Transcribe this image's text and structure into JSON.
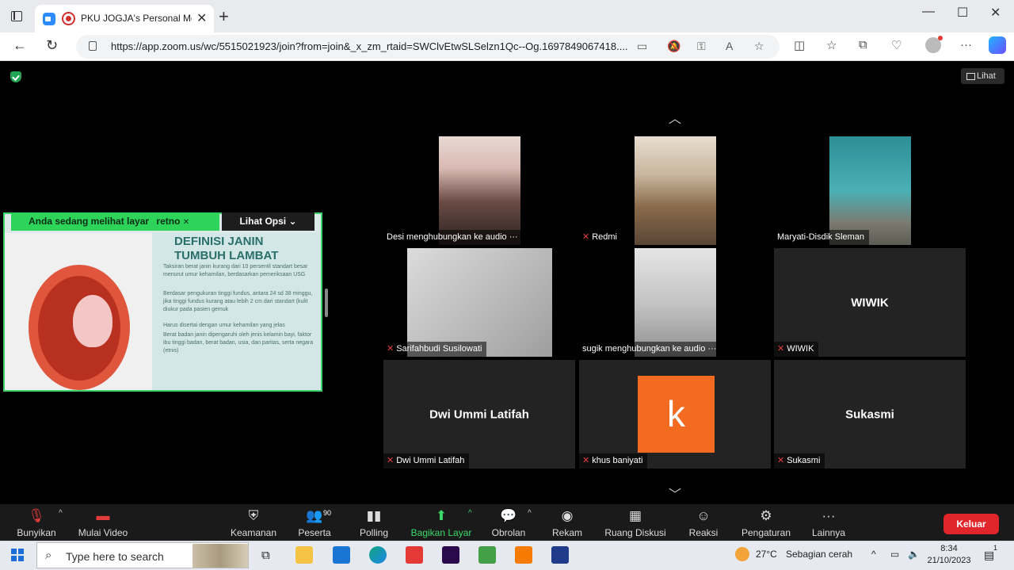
{
  "browser": {
    "tab_title": "PKU JOGJA's Personal Meeti",
    "url": "https://app.zoom.us/wc/5515021923/join?from=join&_x_zm_rtaid=SWClvEtwSLSelzn1Qc--Og.1697849067418...."
  },
  "meeting": {
    "view_label": "Lihat",
    "share_banner": "Anda sedang melihat layar",
    "share_owner": "retno",
    "share_options": "Lihat Opsi",
    "slide": {
      "title_line1": "DEFINISI JANIN",
      "title_line2": "TUMBUH LAMBAT",
      "bullets": [
        "Taksiran berat janin kurang dari 10 persentil standart besar menurut umur kehamilan, berdasarkan pemeriksaan USG",
        "Berdasar pengukuran tinggi fundus, antara 24 sd 38 minggu, jika tinggi fundus kurang atau lebih 2 cm dari standart (kulit diukur pada pasien gemuk",
        "Harus disertai dengan umur kehamilan yang jelas",
        "Berat badan janin dipengaruhi oleh jenis kelamin bayi, faktor ibu tinggi badan, berat badan, usia, dan paritas, serta negara (etnis)"
      ]
    },
    "participants": [
      {
        "name": "Desi menghubungkan ke audio",
        "center": ""
      },
      {
        "name": "Redmi",
        "center": ""
      },
      {
        "name": "Maryati-Disdik Sleman",
        "center": ""
      },
      {
        "name": "Sarifahbudi Susilowati",
        "center": ""
      },
      {
        "name": "sugik menghubungkan ke audio",
        "center": ""
      },
      {
        "name": "WIWIK",
        "center": "WIWIK"
      },
      {
        "name": "Dwi Ummi Latifah",
        "center": "Dwi Ummi Latifah"
      },
      {
        "name": "khus baniyati",
        "center": "k"
      },
      {
        "name": "Sukasmi",
        "center": "Sukasmi"
      }
    ],
    "toolbar": {
      "unmute": "Bunyikan",
      "start_video": "Mulai Video",
      "security": "Keamanan",
      "participants": "Peserta",
      "participant_count": "90",
      "polling": "Polling",
      "share_screen": "Bagikan Layar",
      "chat": "Obrolan",
      "record": "Rekam",
      "breakout": "Ruang Diskusi",
      "reactions": "Reaksi",
      "settings": "Pengaturan",
      "more": "Lainnya",
      "leave": "Keluar"
    }
  },
  "taskbar": {
    "search_placeholder": "Type here to search",
    "weather_temp": "27°C",
    "weather_desc": "Sebagian cerah",
    "time": "8:34",
    "date": "21/10/2023",
    "notification_count": "1"
  }
}
